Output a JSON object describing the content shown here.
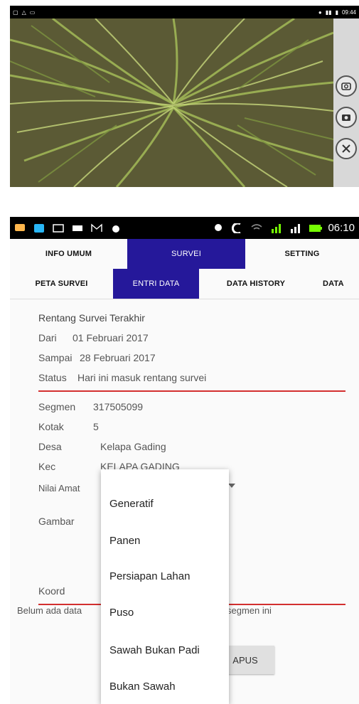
{
  "camera_screen": {
    "status_bar": {
      "time": "09:44"
    },
    "icons": [
      "rotate-camera-icon",
      "camera-icon",
      "close-icon"
    ]
  },
  "status_bar": {
    "time": "06:10"
  },
  "main_tabs": [
    "INFO UMUM",
    "SURVEI",
    "SETTING"
  ],
  "sub_tabs": [
    "PETA SURVEI",
    "ENTRI DATA",
    "DATA HISTORY",
    "DATA"
  ],
  "survey_range": {
    "heading": "Rentang Survei Terakhir",
    "from_label": "Dari",
    "from_value": "01 Februari 2017",
    "to_label": "Sampai",
    "to_value": "28 Februari 2017",
    "status_label": "Status",
    "status_value": "Hari ini masuk rentang survei"
  },
  "fields": {
    "segmen_label": "Segmen",
    "segmen_value": "317505099",
    "kotak_label": "Kotak",
    "kotak_value": "5",
    "desa_label": "Desa",
    "desa_value": "Kelapa Gading",
    "kec_label": "Kec",
    "kec_value": "KELAPA GADING",
    "nilai_amat_label": "Nilai Amat",
    "gambar_label": "Gambar",
    "koord_label": "Koord"
  },
  "info_message_left": "Belum ada data",
  "info_message_right": "segmen ini",
  "hapus_button_label": "APUS",
  "dropdown_options": [
    "Generatif",
    "Panen",
    "Persiapan Lahan",
    "Puso",
    "Sawah Bukan Padi",
    "Bukan Sawah"
  ],
  "colors": {
    "accent": "#25189a",
    "divider": "#d32f2f"
  }
}
